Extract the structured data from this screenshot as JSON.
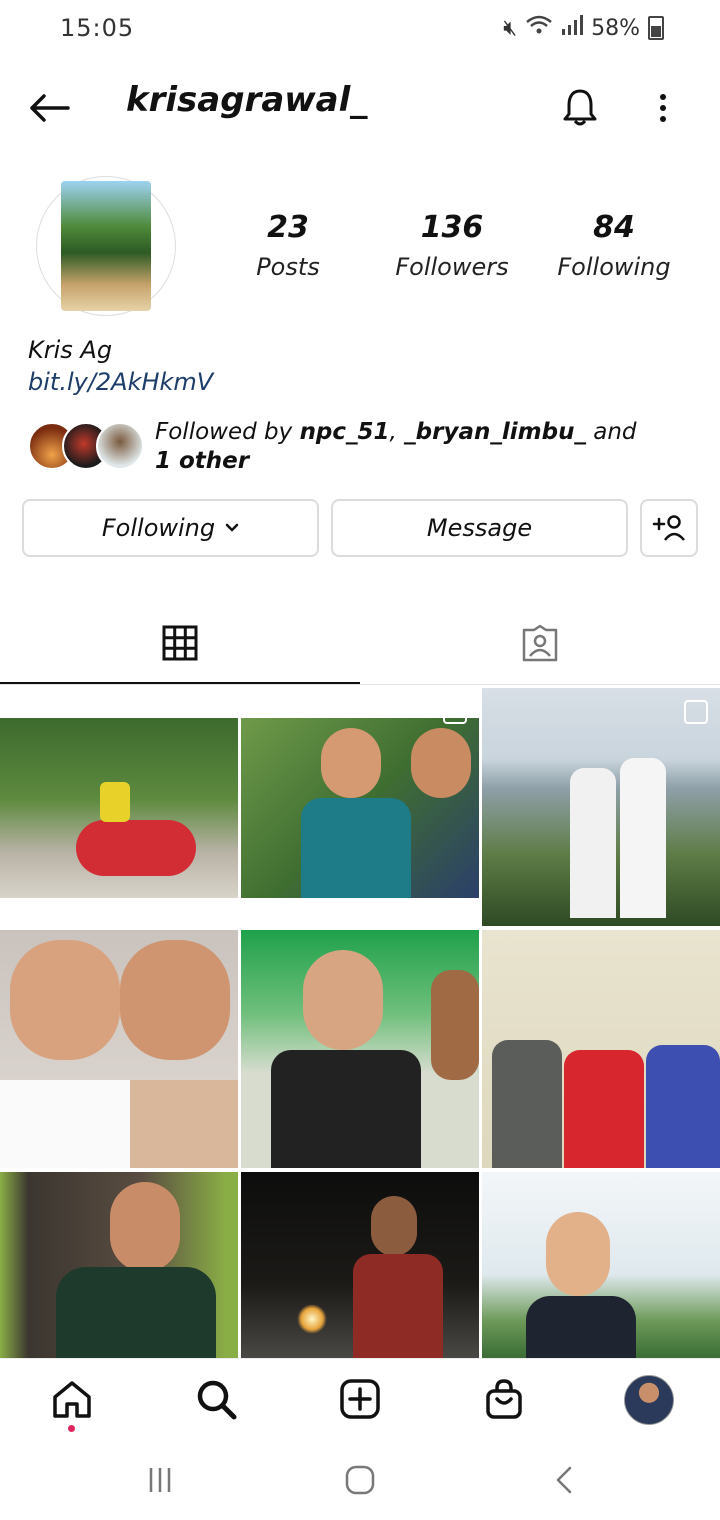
{
  "status_bar": {
    "time": "15:05",
    "battery": "58%"
  },
  "header": {
    "username": "krisagrawal_",
    "icons": [
      "back-arrow-icon",
      "bell-icon",
      "more-vertical-icon"
    ]
  },
  "stats": [
    {
      "value": "23",
      "label": "Posts"
    },
    {
      "value": "136",
      "label": "Followers"
    },
    {
      "value": "84",
      "label": "Following"
    }
  ],
  "bio": {
    "name": "Kris Ag",
    "link": "bit.ly/2AkHkmV"
  },
  "followed_by": {
    "prefix": "Followed by ",
    "user1": "npc_51",
    "sep": ", ",
    "user2": "_bryan_limbu_",
    "suffix": " and ",
    "tail": "1 other"
  },
  "actions": {
    "following": "Following",
    "message": "Message"
  },
  "tabs": [
    "grid-icon",
    "tagged-icon"
  ],
  "bottom_nav": [
    "home-icon",
    "search-icon",
    "add-post-icon",
    "shop-icon",
    "profile-avatar"
  ],
  "colors": {
    "link": "#1d3d6a",
    "notification_dot": "#e0245e"
  }
}
